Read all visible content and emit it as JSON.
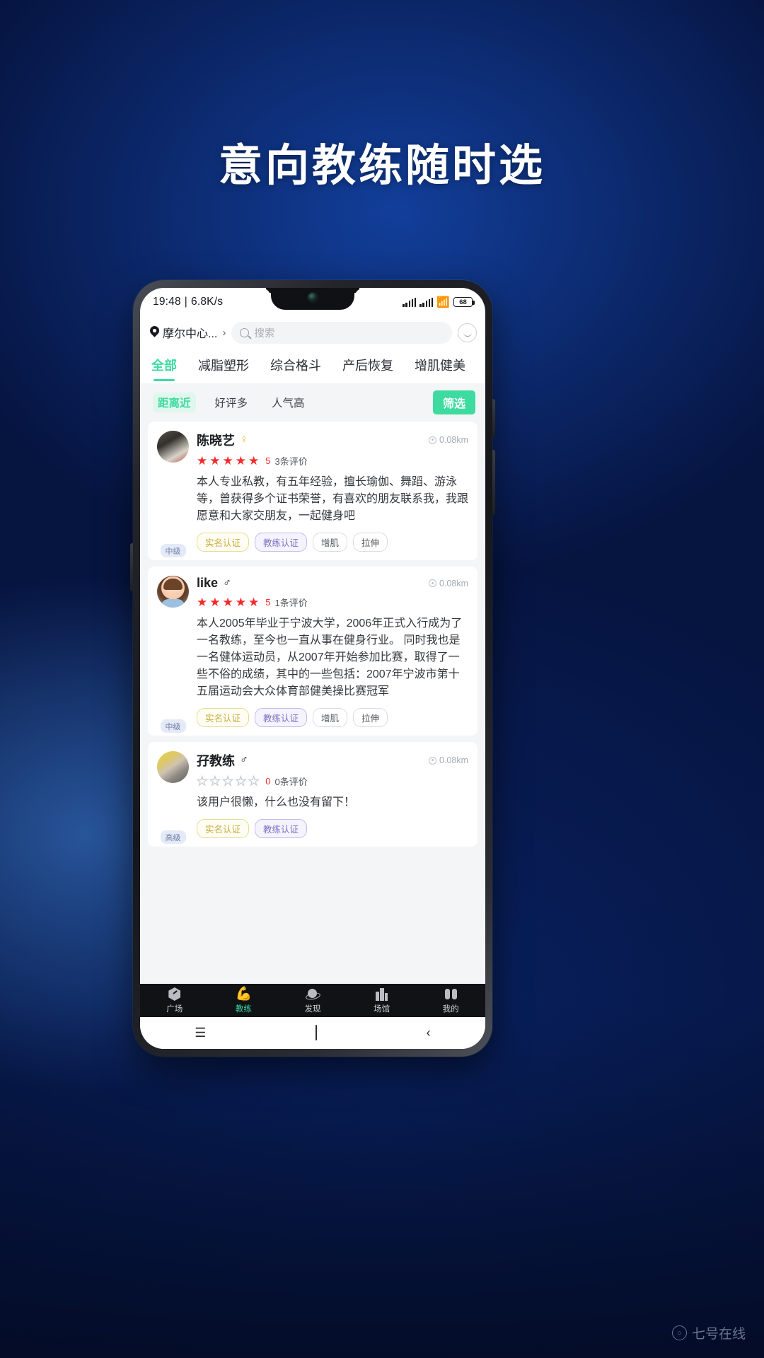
{
  "headline": "意向教练随时选",
  "watermark": {
    "text": "七号在线",
    "icon": "search-circle-icon"
  },
  "colors": {
    "accent": "#3ddba0",
    "star": "#f42a2a",
    "bg_deep": "#07205c",
    "tag_real": "#c9ad3c",
    "tag_coach": "#7d71c4"
  },
  "statusbar": {
    "time": "19:48",
    "separator": "|",
    "netspeed": "6.8K/s",
    "battery": "68"
  },
  "header": {
    "location": "摩尔中心...",
    "location_chevron": "›",
    "search_placeholder": "搜索",
    "smiley_icon": "smiley-face-icon"
  },
  "tabs": [
    {
      "label": "全部",
      "active": true
    },
    {
      "label": "减脂塑形",
      "active": false
    },
    {
      "label": "综合格斗",
      "active": false
    },
    {
      "label": "产后恢复",
      "active": false
    },
    {
      "label": "增肌健美",
      "active": false
    }
  ],
  "filters": {
    "chips": [
      {
        "label": "距离近",
        "active": true
      },
      {
        "label": "好评多",
        "active": false
      },
      {
        "label": "人气高",
        "active": false
      }
    ],
    "filter_button": "筛选"
  },
  "coaches": [
    {
      "name": "陈晓艺",
      "gender": "♀",
      "gender_class": "f",
      "level": "中级",
      "distance": "0.08km",
      "stars": 5,
      "score": "5",
      "reviews": "3条评价",
      "desc": "本人专业私教，有五年经验，擅长瑜伽、舞蹈、游泳等，曾获得多个证书荣誉，有喜欢的朋友联系我，我跟愿意和大家交朋友，一起健身吧",
      "tags": [
        "实名认证",
        "教练认证",
        "增肌",
        "拉伸"
      ]
    },
    {
      "name": "like",
      "gender": "♂",
      "gender_class": "m",
      "level": "中级",
      "distance": "0.08km",
      "stars": 5,
      "score": "5",
      "reviews": "1条评价",
      "desc": "本人2005年毕业于宁波大学，2006年正式入行成为了一名教练，至今也一直从事在健身行业。 同时我也是一名健体运动员，从2007年开始参加比赛，取得了一些不俗的成绩，其中的一些包括：2007年宁波市第十五届运动会大众体育部健美操比赛冠军",
      "tags": [
        "实名认证",
        "教练认证",
        "增肌",
        "拉伸"
      ]
    },
    {
      "name": "孖教练",
      "gender": "♂",
      "gender_class": "m",
      "level": "高级",
      "distance": "0.08km",
      "stars": 0,
      "score": "0",
      "reviews": "0条评价",
      "desc": "该用户很懒，什么也没有留下！",
      "tags": [
        "实名认证",
        "教练认证"
      ]
    }
  ],
  "bottom_nav": [
    {
      "label": "广场",
      "icon": "hexagon-compass-icon",
      "active": false
    },
    {
      "label": "教练",
      "icon": "muscle-arm-icon",
      "active": true
    },
    {
      "label": "发现",
      "icon": "planet-icon",
      "active": false
    },
    {
      "label": "场馆",
      "icon": "building-icon",
      "active": false
    },
    {
      "label": "我的",
      "icon": "person-icon",
      "active": false
    }
  ],
  "android_nav": {
    "menu": "☰",
    "home": "home-square-icon",
    "back": "‹"
  }
}
